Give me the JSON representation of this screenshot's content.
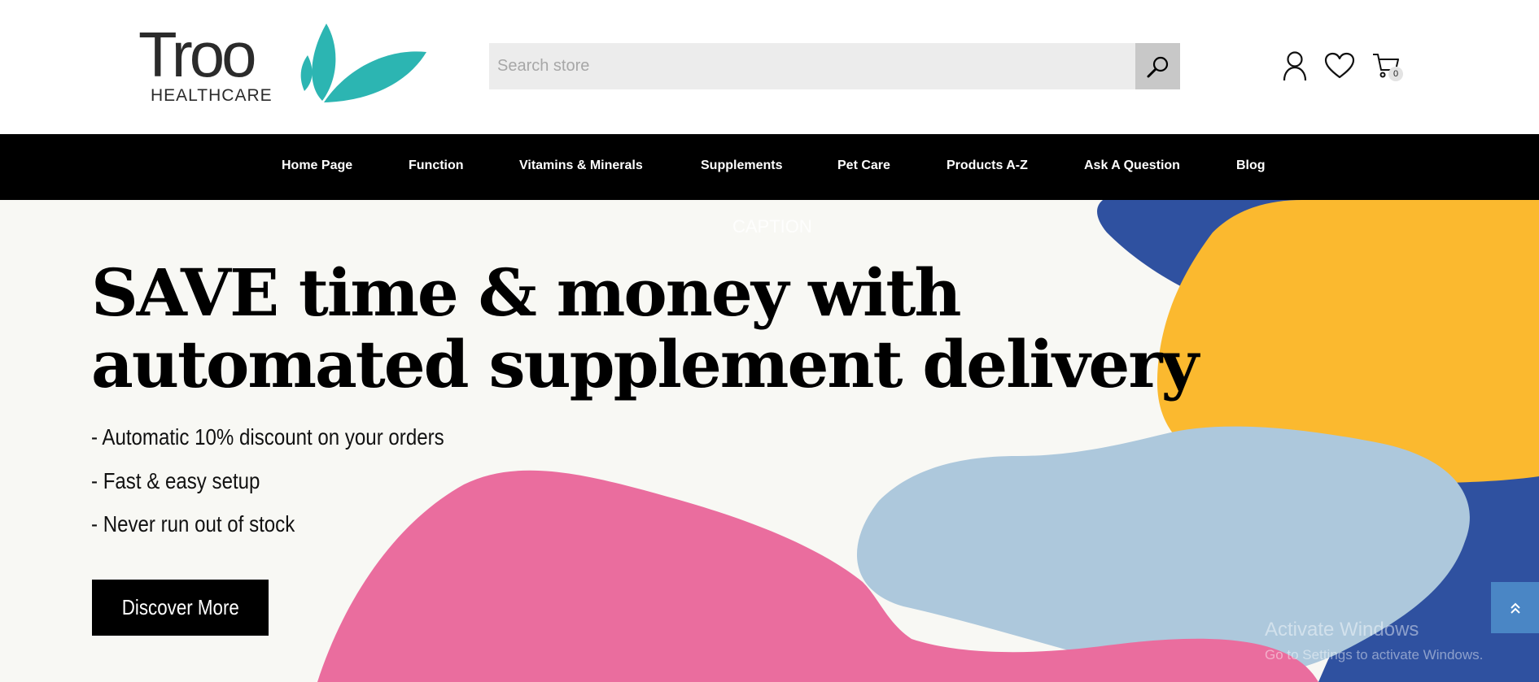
{
  "brand": {
    "name": "Troo",
    "subtitle": "HEALTHCARE",
    "accent_color": "#2cb5b2",
    "logo_icon": "leaf-icon"
  },
  "search": {
    "placeholder": "Search store",
    "value": "",
    "button_icon": "search-icon"
  },
  "header_icons": {
    "account": "user-icon",
    "wishlist": "heart-icon",
    "cart": "cart-icon",
    "cart_count": "0"
  },
  "nav": {
    "items": [
      {
        "label": "Home Page"
      },
      {
        "label": "Function"
      },
      {
        "label": "Vitamins & Minerals"
      },
      {
        "label": "Supplements"
      },
      {
        "label": "Pet Care"
      },
      {
        "label": "Products A-Z"
      },
      {
        "label": "Ask A Question"
      },
      {
        "label": "Blog"
      }
    ]
  },
  "hero": {
    "caption": "CAPTION",
    "headline_line1": "SAVE time & money with",
    "headline_line2": "automated supplement delivery",
    "bullets": [
      "- Automatic 10% discount on your orders",
      "- Fast & easy setup",
      "- Never run out of stock"
    ],
    "cta_label": "Discover More",
    "colors": {
      "background": "#f8f8f4",
      "blue": "#2f51a0",
      "yellow": "#fbb92f",
      "light_blue": "#adc8dc",
      "pink": "#ea6d9e"
    }
  },
  "overlay": {
    "activation_title": "Activate Windows",
    "activation_sub": "Go to Settings to activate Windows.",
    "scroll_top_icon": "double-chevron-up-icon"
  }
}
